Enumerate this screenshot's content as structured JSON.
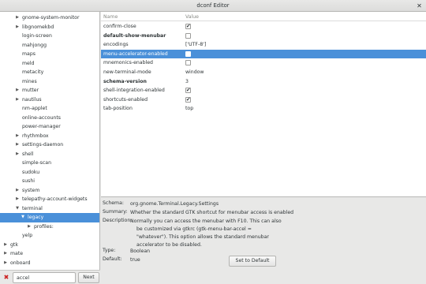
{
  "window": {
    "title": "dconf Editor",
    "close_icon": "✕"
  },
  "tree": {
    "items": [
      {
        "label": "gnome-system-monitor",
        "expander": "right"
      },
      {
        "label": "libgnomekbd",
        "expander": "right"
      },
      {
        "label": "login-screen",
        "expander": ""
      },
      {
        "label": "mahjongg",
        "expander": ""
      },
      {
        "label": "maps",
        "expander": ""
      },
      {
        "label": "meld",
        "expander": ""
      },
      {
        "label": "metacity",
        "expander": ""
      },
      {
        "label": "mines",
        "expander": ""
      },
      {
        "label": "mutter",
        "expander": "right"
      },
      {
        "label": "nautilus",
        "expander": "right"
      },
      {
        "label": "nm-applet",
        "expander": ""
      },
      {
        "label": "online-accounts",
        "expander": ""
      },
      {
        "label": "power-manager",
        "expander": ""
      },
      {
        "label": "rhythmbox",
        "expander": "right"
      },
      {
        "label": "settings-daemon",
        "expander": "right"
      },
      {
        "label": "shell",
        "expander": "right"
      },
      {
        "label": "simple-scan",
        "expander": ""
      },
      {
        "label": "sudoku",
        "expander": ""
      },
      {
        "label": "sushi",
        "expander": ""
      },
      {
        "label": "system",
        "expander": "right"
      },
      {
        "label": "telepathy-account-widgets",
        "expander": "right"
      },
      {
        "label": "terminal",
        "expander": "down"
      },
      {
        "label": "legacy",
        "expander": "down",
        "selected": true
      },
      {
        "label": "profiles:",
        "expander": "right"
      },
      {
        "label": "yelp",
        "expander": ""
      },
      {
        "label": "gtk",
        "expander": "right"
      },
      {
        "label": "mate",
        "expander": "right"
      },
      {
        "label": "onboard",
        "expander": "right"
      }
    ]
  },
  "search": {
    "value": "accel",
    "clear_icon": "✖",
    "next_label": "Next"
  },
  "keylist": {
    "header_name": "Name",
    "header_value": "Value",
    "check_mark": "✔",
    "rows": [
      {
        "name": "confirm-close",
        "type": "bool",
        "checked": true
      },
      {
        "name": "default-show-menubar",
        "type": "bool",
        "checked": false,
        "bold": true
      },
      {
        "name": "encodings",
        "type": "text",
        "value": "['UTF-8']"
      },
      {
        "name": "menu-accelerator-enabled",
        "type": "bool",
        "checked": false,
        "selected": true
      },
      {
        "name": "mnemonics-enabled",
        "type": "bool",
        "checked": false
      },
      {
        "name": "new-terminal-mode",
        "type": "text",
        "value": "window"
      },
      {
        "name": "schema-version",
        "type": "text",
        "value": "3",
        "bold": true
      },
      {
        "name": "shell-integration-enabled",
        "type": "bool",
        "checked": true
      },
      {
        "name": "shortcuts-enabled",
        "type": "bool",
        "checked": true
      },
      {
        "name": "tab-position",
        "type": "text",
        "value": "top"
      }
    ]
  },
  "details": {
    "schema_label": "Schema:",
    "schema_value": "org.gnome.Terminal.Legacy.Settings",
    "summary_label": "Summary:",
    "summary_value": "Whether the standard GTK shortcut for menubar access is enabled",
    "description_label": "Description:",
    "description_lines": [
      "Normally you can access the menubar with F10. This can also",
      "be customized via gtkrc (gtk-menu-bar-accel =",
      "\"whatever\"). This option allows the standard menubar",
      "accelerator to be disabled."
    ],
    "type_label": "Type:",
    "type_value": "Boolean",
    "default_label": "Default:",
    "default_value": "true",
    "set_default_label": "Set to Default"
  }
}
